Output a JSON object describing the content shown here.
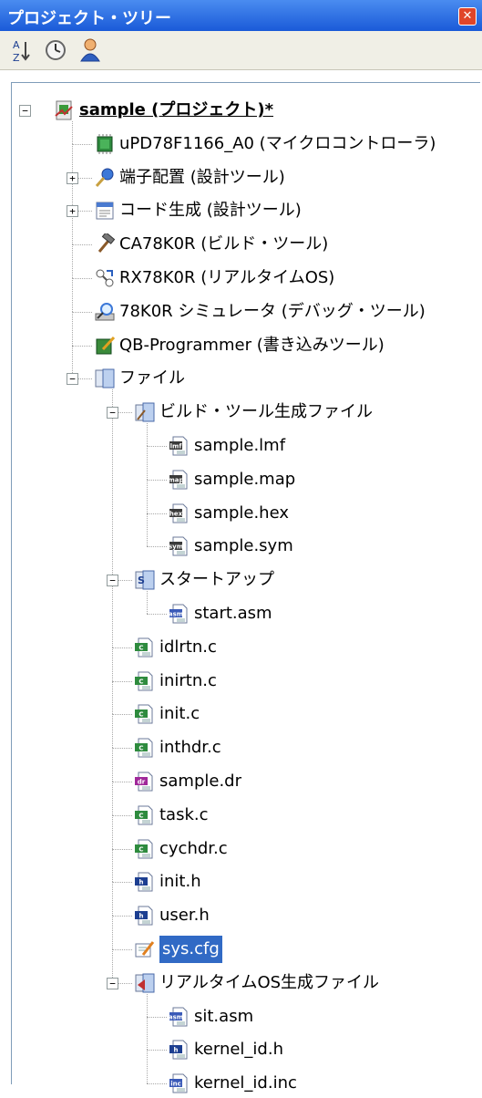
{
  "panel": {
    "title": "プロジェクト・ツリー"
  },
  "toolbar": {
    "sort_icon": "sort-icon",
    "clock_icon": "clock-icon",
    "person_icon": "person-icon"
  },
  "tree": [
    {
      "label": "sample (プロジェクト)*",
      "icon": "project-icon",
      "level": 0,
      "expander": "minus",
      "bold": true
    },
    {
      "label": "uPD78F1166_A0 (マイクロコントローラ)",
      "icon": "chip-icon",
      "level": 1
    },
    {
      "label": "端子配置 (設計ツール)",
      "icon": "pin-tool-icon",
      "level": 1,
      "expander": "plus"
    },
    {
      "label": "コード生成 (設計ツール)",
      "icon": "codegen-icon",
      "level": 1,
      "expander": "plus"
    },
    {
      "label": "CA78K0R (ビルド・ツール)",
      "icon": "hammer-icon",
      "level": 1
    },
    {
      "label": "RX78K0R (リアルタイムOS)",
      "icon": "rtos-icon",
      "level": 1
    },
    {
      "label": "78K0R シミュレータ (デバッグ・ツール)",
      "icon": "simulator-icon",
      "level": 1
    },
    {
      "label": "QB-Programmer (書き込みツール)",
      "icon": "programmer-icon",
      "level": 1
    },
    {
      "label": "ファイル",
      "icon": "folder-icon",
      "level": 1,
      "expander": "minus"
    },
    {
      "label": "ビルド・ツール生成ファイル",
      "icon": "build-folder-icon",
      "level": 2,
      "expander": "minus"
    },
    {
      "label": "sample.lmf",
      "icon": "lmf-file-icon",
      "level": 3
    },
    {
      "label": "sample.map",
      "icon": "map-file-icon",
      "level": 3
    },
    {
      "label": "sample.hex",
      "icon": "hex-file-icon",
      "level": 3
    },
    {
      "label": "sample.sym",
      "icon": "sym-file-icon",
      "level": 3
    },
    {
      "label": "スタートアップ",
      "icon": "startup-folder-icon",
      "level": 2,
      "expander": "minus"
    },
    {
      "label": "start.asm",
      "icon": "asm-file-icon",
      "level": 3
    },
    {
      "label": "idlrtn.c",
      "icon": "c-file-icon",
      "level": 2
    },
    {
      "label": "inirtn.c",
      "icon": "c-file-icon",
      "level": 2
    },
    {
      "label": "init.c",
      "icon": "c-file-icon",
      "level": 2
    },
    {
      "label": "inthdr.c",
      "icon": "c-file-icon",
      "level": 2
    },
    {
      "label": "sample.dr",
      "icon": "dr-file-icon",
      "level": 2
    },
    {
      "label": "task.c",
      "icon": "c-file-icon",
      "level": 2
    },
    {
      "label": "cychdr.c",
      "icon": "c-file-icon",
      "level": 2
    },
    {
      "label": "init.h",
      "icon": "h-file-icon",
      "level": 2
    },
    {
      "label": "user.h",
      "icon": "h-file-icon",
      "level": 2
    },
    {
      "label": "sys.cfg",
      "icon": "cfg-file-icon",
      "level": 2,
      "selected": true
    },
    {
      "label": "リアルタイムOS生成ファイル",
      "icon": "rtos-folder-icon",
      "level": 2,
      "expander": "minus"
    },
    {
      "label": "sit.asm",
      "icon": "asm-file-icon",
      "level": 3
    },
    {
      "label": "kernel_id.h",
      "icon": "h-file-icon",
      "level": 3
    },
    {
      "label": "kernel_id.inc",
      "icon": "inc-file-icon",
      "level": 3
    }
  ]
}
